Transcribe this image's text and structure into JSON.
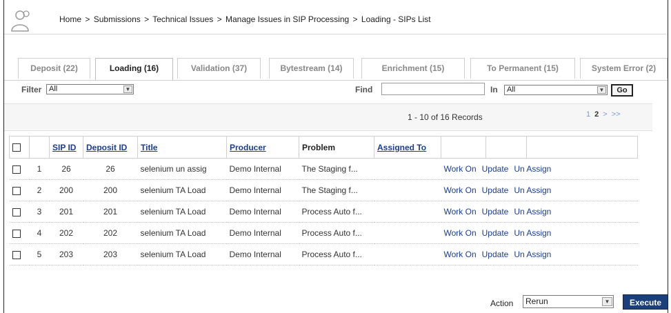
{
  "breadcrumb": [
    "Home",
    "Submissions",
    "Technical Issues",
    "Manage Issues in SIP Processing",
    "Loading - SIPs List"
  ],
  "breadcrumb_sep": ">",
  "tabs": [
    {
      "label": "Deposit (22)",
      "active": false
    },
    {
      "label": "Loading (16)",
      "active": true
    },
    {
      "label": "Validation (37)",
      "active": false
    },
    {
      "label": "Bytestream (14)",
      "active": false
    },
    {
      "label": "Enrichment (15)",
      "active": false
    },
    {
      "label": "To Permanent (15)",
      "active": false
    },
    {
      "label": "System Error (2)",
      "active": false
    }
  ],
  "filter": {
    "label": "Filter",
    "value": "All"
  },
  "find": {
    "label": "Find",
    "value": ""
  },
  "in": {
    "label": "In",
    "value": "All"
  },
  "go_label": "Go",
  "records_text": "1 - 10 of 16 Records",
  "pager": {
    "pages": [
      "1",
      "2"
    ],
    "current": "2",
    "next": ">",
    "last": ">>"
  },
  "table": {
    "headers": [
      "SIP ID",
      "Deposit ID",
      "Title",
      "Producer",
      "Problem",
      "Assigned To"
    ],
    "rows": [
      {
        "index": "1",
        "sip_id": "26",
        "deposit_id": "26",
        "title": "selenium un assig",
        "producer": "Demo Internal",
        "problem": "The Staging f...",
        "assigned_to": ""
      },
      {
        "index": "2",
        "sip_id": "200",
        "deposit_id": "200",
        "title": "selenium TA Load",
        "producer": "Demo Internal",
        "problem": "The Staging f...",
        "assigned_to": ""
      },
      {
        "index": "3",
        "sip_id": "201",
        "deposit_id": "201",
        "title": "selenium TA Load",
        "producer": "Demo Internal",
        "problem": "Process Auto f...",
        "assigned_to": ""
      },
      {
        "index": "4",
        "sip_id": "202",
        "deposit_id": "202",
        "title": "selenium TA Load",
        "producer": "Demo Internal",
        "problem": "Process Auto f...",
        "assigned_to": ""
      },
      {
        "index": "5",
        "sip_id": "203",
        "deposit_id": "203",
        "title": "selenium TA Load",
        "producer": "Demo Internal",
        "problem": "Process Auto f...",
        "assigned_to": ""
      }
    ],
    "row_actions": [
      "Work On",
      "Update",
      "Un Assign"
    ]
  },
  "action": {
    "label": "Action",
    "value": "Rerun",
    "execute_label": "Execute"
  },
  "colors": {
    "link": "#1a3d8f",
    "execute_bg": "#1b3f7a",
    "tab_inactive": "#888888"
  }
}
